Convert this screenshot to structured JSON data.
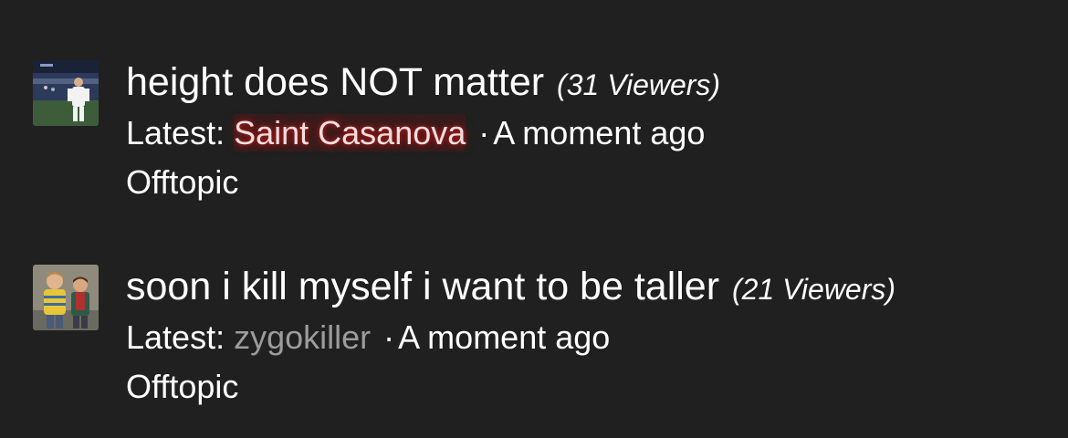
{
  "threads": [
    {
      "title": "height does NOT matter",
      "viewers": "(31 Viewers)",
      "latest_label": "Latest:",
      "latest_user": "Saint Casanova",
      "separator": "·",
      "time": "A moment ago",
      "category": "Offtopic",
      "avatar_icon": "soccer-player-avatar-icon"
    },
    {
      "title": "soon i kill myself i want to be taller",
      "viewers": "(21 Viewers)",
      "latest_label": "Latest:",
      "latest_user": "zygokiller",
      "separator": "·",
      "time": "A moment ago",
      "category": "Offtopic",
      "avatar_icon": "two-boys-avatar-icon"
    }
  ],
  "colors": {
    "background": "#202020",
    "text": "#ffffff",
    "highlight_user": "#f4dede",
    "highlight_glow": "#dc1e1e",
    "plain_user": "#9c9c9c"
  }
}
